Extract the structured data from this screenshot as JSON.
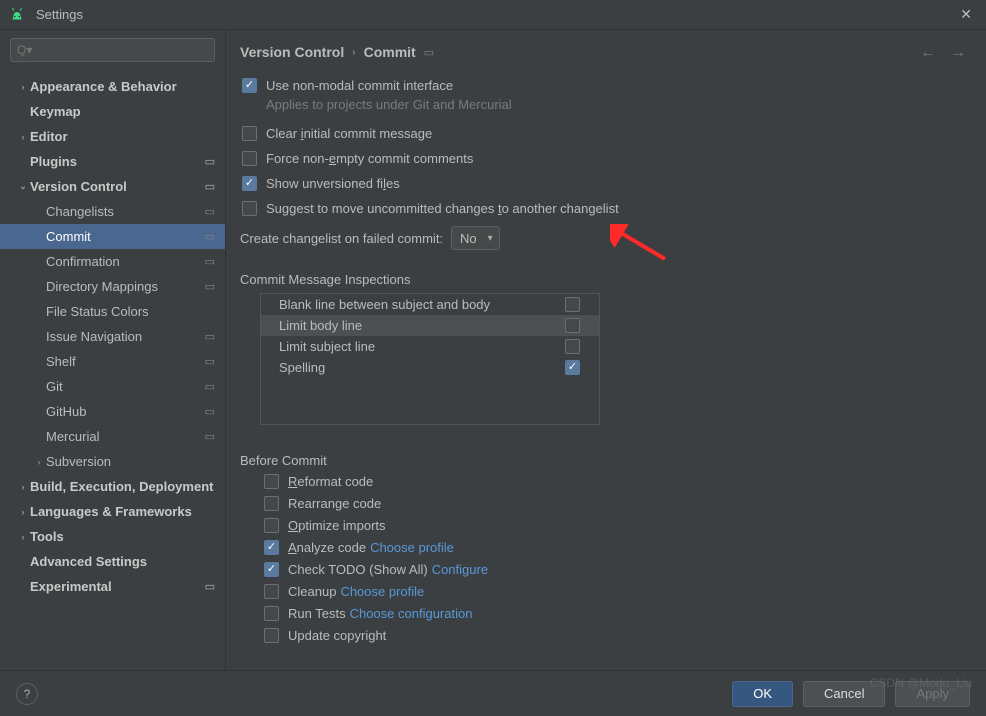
{
  "window": {
    "title": "Settings"
  },
  "search": {
    "placeholder": "Q▾"
  },
  "sidebar": {
    "items": [
      {
        "label": "Appearance & Behavior",
        "indent": 0,
        "chev": "›",
        "bold": true,
        "cfg": false
      },
      {
        "label": "Keymap",
        "indent": 0,
        "chev": "",
        "bold": true,
        "cfg": false
      },
      {
        "label": "Editor",
        "indent": 0,
        "chev": "›",
        "bold": true,
        "cfg": false
      },
      {
        "label": "Plugins",
        "indent": 0,
        "chev": "",
        "bold": true,
        "cfg": true
      },
      {
        "label": "Version Control",
        "indent": 0,
        "chev": "⌄",
        "bold": true,
        "cfg": true
      },
      {
        "label": "Changelists",
        "indent": 1,
        "chev": "",
        "bold": false,
        "cfg": true
      },
      {
        "label": "Commit",
        "indent": 1,
        "chev": "",
        "bold": false,
        "cfg": true,
        "selected": true
      },
      {
        "label": "Confirmation",
        "indent": 1,
        "chev": "",
        "bold": false,
        "cfg": true
      },
      {
        "label": "Directory Mappings",
        "indent": 1,
        "chev": "",
        "bold": false,
        "cfg": true
      },
      {
        "label": "File Status Colors",
        "indent": 1,
        "chev": "",
        "bold": false,
        "cfg": false
      },
      {
        "label": "Issue Navigation",
        "indent": 1,
        "chev": "",
        "bold": false,
        "cfg": true
      },
      {
        "label": "Shelf",
        "indent": 1,
        "chev": "",
        "bold": false,
        "cfg": true
      },
      {
        "label": "Git",
        "indent": 1,
        "chev": "",
        "bold": false,
        "cfg": true
      },
      {
        "label": "GitHub",
        "indent": 1,
        "chev": "",
        "bold": false,
        "cfg": true
      },
      {
        "label": "Mercurial",
        "indent": 1,
        "chev": "",
        "bold": false,
        "cfg": true
      },
      {
        "label": "Subversion",
        "indent": 1,
        "chev": "›",
        "bold": false,
        "cfg": false
      },
      {
        "label": "Build, Execution, Deployment",
        "indent": 0,
        "chev": "›",
        "bold": true,
        "cfg": false
      },
      {
        "label": "Languages & Frameworks",
        "indent": 0,
        "chev": "›",
        "bold": true,
        "cfg": false
      },
      {
        "label": "Tools",
        "indent": 0,
        "chev": "›",
        "bold": true,
        "cfg": false
      },
      {
        "label": "Advanced Settings",
        "indent": 0,
        "chev": "",
        "bold": true,
        "cfg": false
      },
      {
        "label": "Experimental",
        "indent": 0,
        "chev": "",
        "bold": true,
        "cfg": true
      }
    ]
  },
  "breadcrumb": {
    "root": "Version Control",
    "leaf": "Commit"
  },
  "options": {
    "use_nonmodal": "Use non-modal commit interface",
    "use_nonmodal_hint": "Applies to projects under Git and Mercurial",
    "clear_initial": "Clear initial commit message",
    "force_nonempty": "Force non-empty commit comments",
    "show_unversioned": "Show unversioned files",
    "suggest_move": "Suggest to move uncommitted changes to another changelist",
    "create_changelist_label": "Create changelist on failed commit:",
    "create_changelist_value": "No"
  },
  "inspections": {
    "title": "Commit Message Inspections",
    "rows": [
      {
        "label": "Blank line between subject and body",
        "checked": false
      },
      {
        "label": "Limit body line",
        "checked": false
      },
      {
        "label": "Limit subject line",
        "checked": false
      },
      {
        "label": "Spelling",
        "checked": true
      }
    ]
  },
  "before": {
    "title": "Before Commit",
    "items": [
      {
        "label": "Reformat code",
        "checked": false,
        "link": ""
      },
      {
        "label": "Rearrange code",
        "checked": false,
        "link": ""
      },
      {
        "label": "Optimize imports",
        "checked": false,
        "link": ""
      },
      {
        "label": "Analyze code",
        "checked": true,
        "link": "Choose profile"
      },
      {
        "label": "Check TODO (Show All)",
        "checked": true,
        "link": "Configure"
      },
      {
        "label": "Cleanup",
        "checked": false,
        "link": "Choose profile"
      },
      {
        "label": "Run Tests",
        "checked": false,
        "link": "Choose configuration"
      },
      {
        "label": "Update copyright",
        "checked": false,
        "link": ""
      }
    ]
  },
  "footer": {
    "ok": "OK",
    "cancel": "Cancel",
    "apply": "Apply"
  },
  "watermark": "CSDN @Modu_Liu"
}
